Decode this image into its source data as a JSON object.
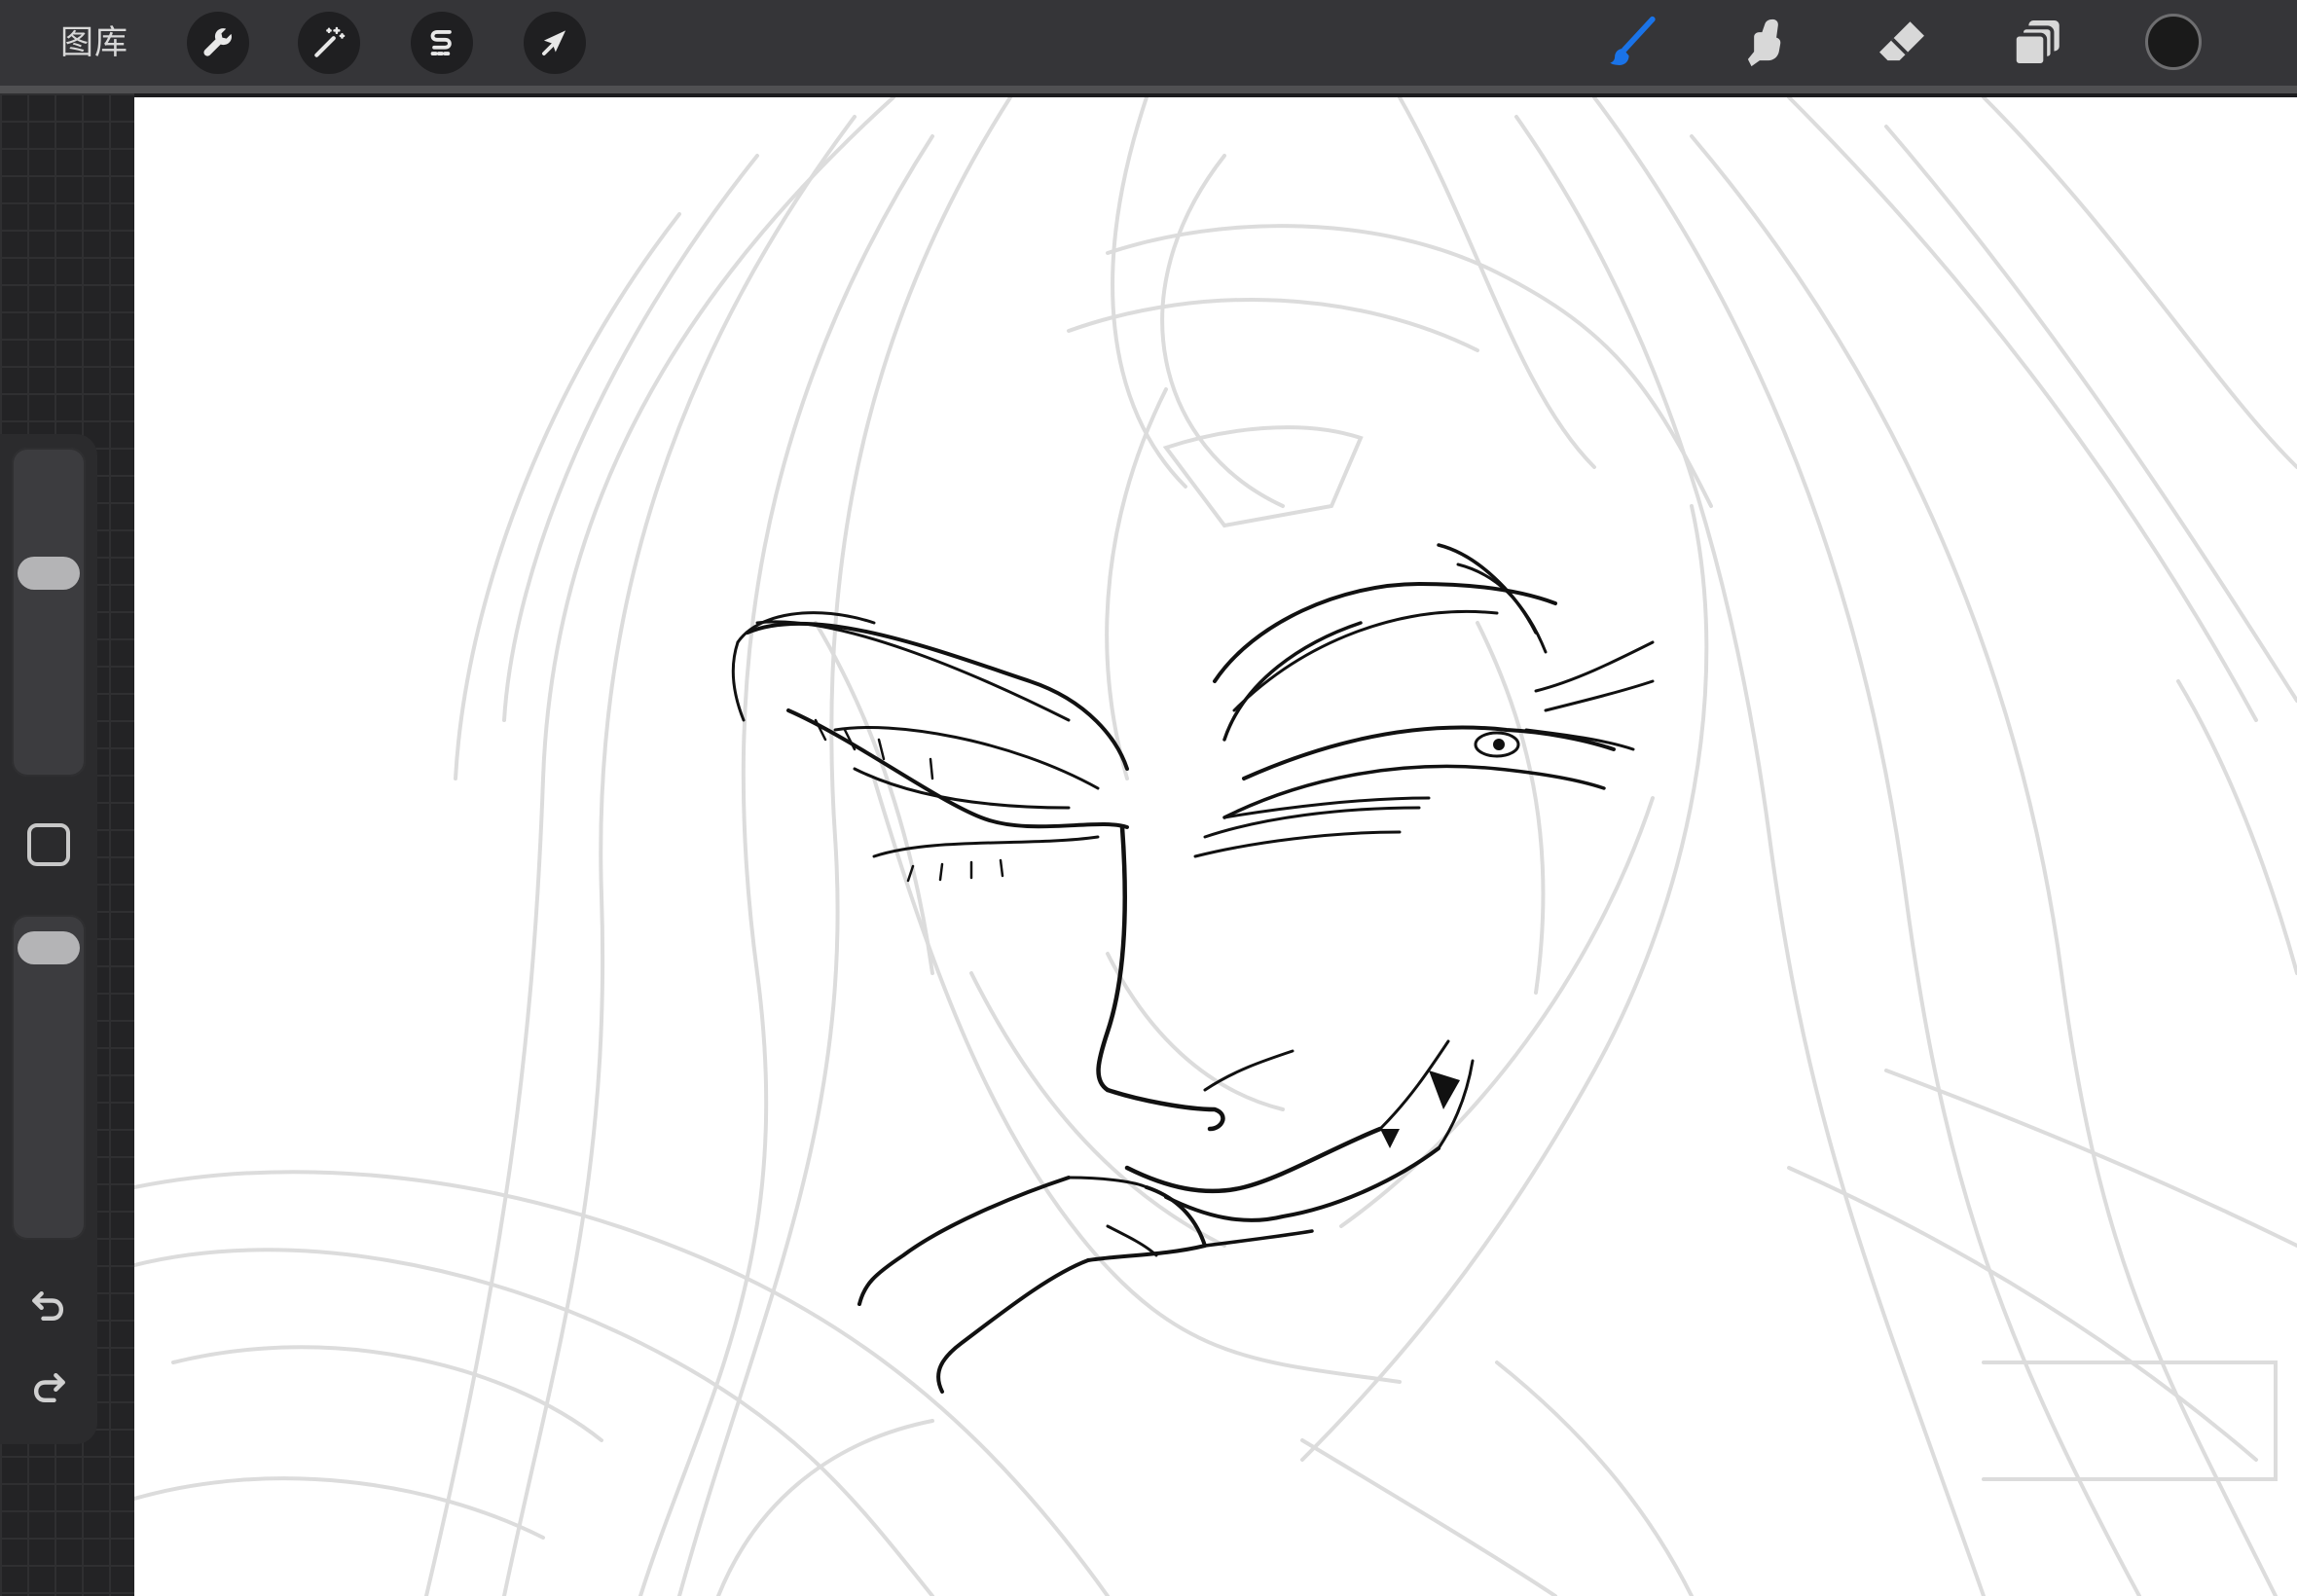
{
  "toolbar": {
    "gallery_label": "图库",
    "left_tools": [
      {
        "name": "actions",
        "icon": "wrench-icon"
      },
      {
        "name": "adjustments",
        "icon": "magic-wand-icon"
      },
      {
        "name": "selection",
        "icon": "selection-s-icon"
      },
      {
        "name": "transform",
        "icon": "arrow-cursor-icon"
      }
    ],
    "right_tools": [
      {
        "name": "brush",
        "icon": "brush-icon",
        "active": true
      },
      {
        "name": "smudge",
        "icon": "smudge-finger-icon",
        "active": false
      },
      {
        "name": "eraser",
        "icon": "eraser-icon",
        "active": false
      },
      {
        "name": "layers",
        "icon": "layers-icon",
        "active": false
      }
    ],
    "current_color": "#1a1a1a"
  },
  "sidebar": {
    "brush_size_level": 0.64,
    "opacity_level": 0.97,
    "modify_button_icon": "square-icon",
    "undo_icon": "undo-icon",
    "redo_icon": "redo-icon"
  },
  "colors": {
    "active_tool": "#1a73e8",
    "toolbar_bg": "#353538",
    "canvas_bg": "#ffffff",
    "sketch_gray": "#dcdcdc",
    "ink": "#111111"
  }
}
